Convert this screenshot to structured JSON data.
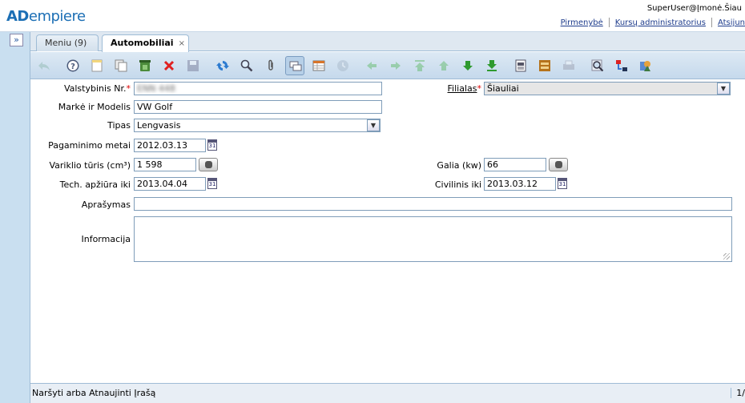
{
  "app": {
    "logo_a": "AD",
    "logo_rest": "empiere"
  },
  "header": {
    "user": "SuperUser@Įmonė.Šiau",
    "links": [
      "Pirmenybė",
      "Kursų administratorius",
      "Atsijun"
    ]
  },
  "tabs": [
    {
      "label": "Meniu (9)",
      "active": false
    },
    {
      "label": "Automobiliai",
      "active": true,
      "close": "×"
    }
  ],
  "toolbar": {
    "icons": [
      "undo-icon",
      "help-icon",
      "new-record-icon",
      "copy-record-icon",
      "delete-selection-icon",
      "delete-icon",
      "save-icon",
      "refresh-icon",
      "find-icon",
      "attachment-icon",
      "chat-icon",
      "grid-toggle-icon",
      "history-icon",
      "parent-icon",
      "detail-icon",
      "first-record-icon",
      "previous-record-icon",
      "next-record-icon",
      "last-record-icon",
      "report-icon",
      "archive-icon",
      "print-icon",
      "zoom-across-icon",
      "workflow-icon",
      "request-icon"
    ]
  },
  "form": {
    "plate": {
      "label": "Valstybinis Nr.",
      "required": "*",
      "value": "ENN 448"
    },
    "branch": {
      "label": "Filialas",
      "required": "*",
      "value": "Šiauliai"
    },
    "model": {
      "label": "Markė ir Modelis",
      "value": "VW Golf"
    },
    "type": {
      "label": "Tipas",
      "value": "Lengvasis"
    },
    "made": {
      "label": "Pagaminimo metai",
      "value": "2012.03.13"
    },
    "engine": {
      "label": "Variklio tūris (cm³)",
      "value": "1 598"
    },
    "power": {
      "label": "Galia (kw)",
      "value": "66"
    },
    "inspection": {
      "label": "Tech. apžiūra iki",
      "value": "2013.04.04"
    },
    "insurance": {
      "label": "Civilinis iki",
      "value": "2013.03.12"
    },
    "description": {
      "label": "Aprašymas",
      "value": ""
    },
    "info": {
      "label": "Informacija",
      "value": ""
    }
  },
  "status": {
    "text": "Naršyti arba Atnaujinti Įrašą",
    "page": "1/"
  },
  "ui_glyphs": {
    "expand": "»",
    "dropdown": "▼",
    "calendar": "31"
  }
}
